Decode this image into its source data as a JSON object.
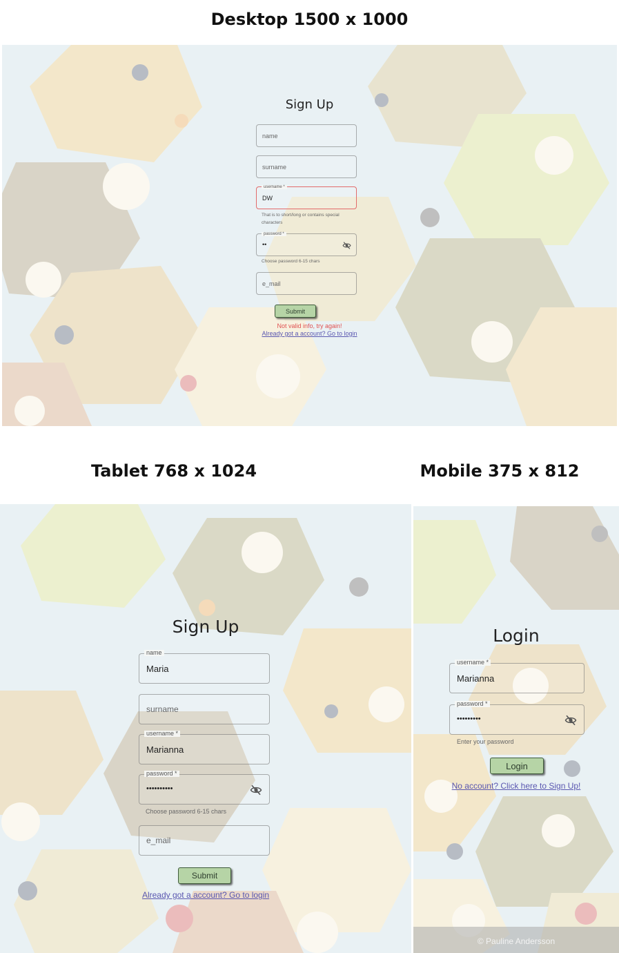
{
  "headings": {
    "desktop": "Desktop 1500 x 1000",
    "tablet": "Tablet 768 x 1024",
    "mobile": "Mobile 375 x 812"
  },
  "desktop": {
    "title": "Sign Up",
    "name_placeholder": "name",
    "surname_placeholder": "surname",
    "username_label": "username *",
    "username_value": "DW",
    "username_error": "That is to short/long or contains special characters",
    "password_label": "password *",
    "password_value": "••",
    "password_helper": "Choose password 6-15 chars",
    "email_placeholder": "e_mail",
    "submit_label": "Submit",
    "error_message": "Not valid info, try again!",
    "login_link": "Already got a account? Go to login"
  },
  "tablet": {
    "title": "Sign Up",
    "name_label": "name",
    "name_value": "Maria",
    "surname_placeholder": "surname",
    "username_label": "username *",
    "username_value": "Marianna",
    "password_label": "password *",
    "password_value": "••••••••••",
    "password_helper": "Choose password 6-15 chars",
    "email_placeholder": "e_mail",
    "submit_label": "Submit",
    "login_link": "Already got a account? Go to login"
  },
  "mobile": {
    "title": "Login",
    "username_label": "username *",
    "username_value": "Marianna",
    "password_label": "password *",
    "password_value": "•••••••••",
    "password_helper": "Enter your password",
    "login_label": "Login",
    "signup_link": "No account? Click here to Sign Up!",
    "footer": "© Pauline Andersson"
  },
  "icons": {
    "visibility_toggle": "eye-off-icon"
  },
  "colors": {
    "button_fill": "#b6d4a6",
    "button_border": "#3e5a3a",
    "error": "#e05050",
    "link": "#5a57b0",
    "field_error_border": "#e26a6a"
  }
}
